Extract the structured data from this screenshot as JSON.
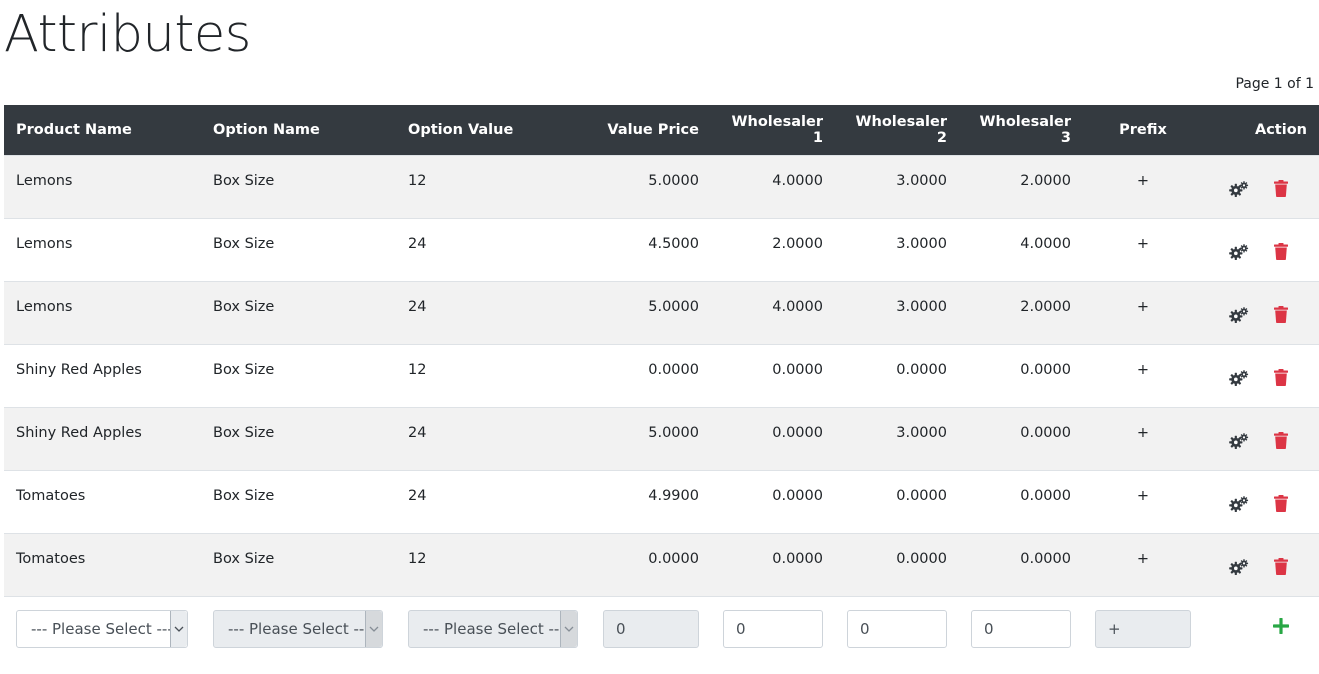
{
  "title": "Attributes",
  "pagination": "Page 1 of 1",
  "colors": {
    "header_bg": "#343a40",
    "delete": "#dc3545",
    "add": "#28a745",
    "gear": "#343a40"
  },
  "table": {
    "headers": [
      "Product Name",
      "Option Name",
      "Option Value",
      "Value Price",
      "Wholesaler 1",
      "Wholesaler 2",
      "Wholesaler 3",
      "Prefix",
      "Action"
    ],
    "rows": [
      [
        "Lemons",
        "Box Size",
        "12",
        "5.0000",
        "4.0000",
        "3.0000",
        "2.0000",
        "+"
      ],
      [
        "Lemons",
        "Box Size",
        "24",
        "4.5000",
        "2.0000",
        "3.0000",
        "4.0000",
        "+"
      ],
      [
        "Lemons",
        "Box Size",
        "24",
        "5.0000",
        "4.0000",
        "3.0000",
        "2.0000",
        "+"
      ],
      [
        "Shiny Red Apples",
        "Box Size",
        "12",
        "0.0000",
        "0.0000",
        "0.0000",
        "0.0000",
        "+"
      ],
      [
        "Shiny Red Apples",
        "Box Size",
        "24",
        "5.0000",
        "0.0000",
        "3.0000",
        "0.0000",
        "+"
      ],
      [
        "Tomatoes",
        "Box Size",
        "24",
        "4.9900",
        "0.0000",
        "0.0000",
        "0.0000",
        "+"
      ],
      [
        "Tomatoes",
        "Box Size",
        "12",
        "0.0000",
        "0.0000",
        "0.0000",
        "0.0000",
        "+"
      ]
    ],
    "row_action_icons": [
      "gears-icon",
      "trash-icon"
    ]
  },
  "new_row": {
    "product_select": "--- Please Select ---",
    "option_select": "--- Please Select ---",
    "value_select": "--- Please Select ---",
    "value_price": "0",
    "wholesaler_1": "0",
    "wholesaler_2": "0",
    "wholesaler_3": "0",
    "prefix": "+",
    "add_icon": "plus-icon"
  }
}
